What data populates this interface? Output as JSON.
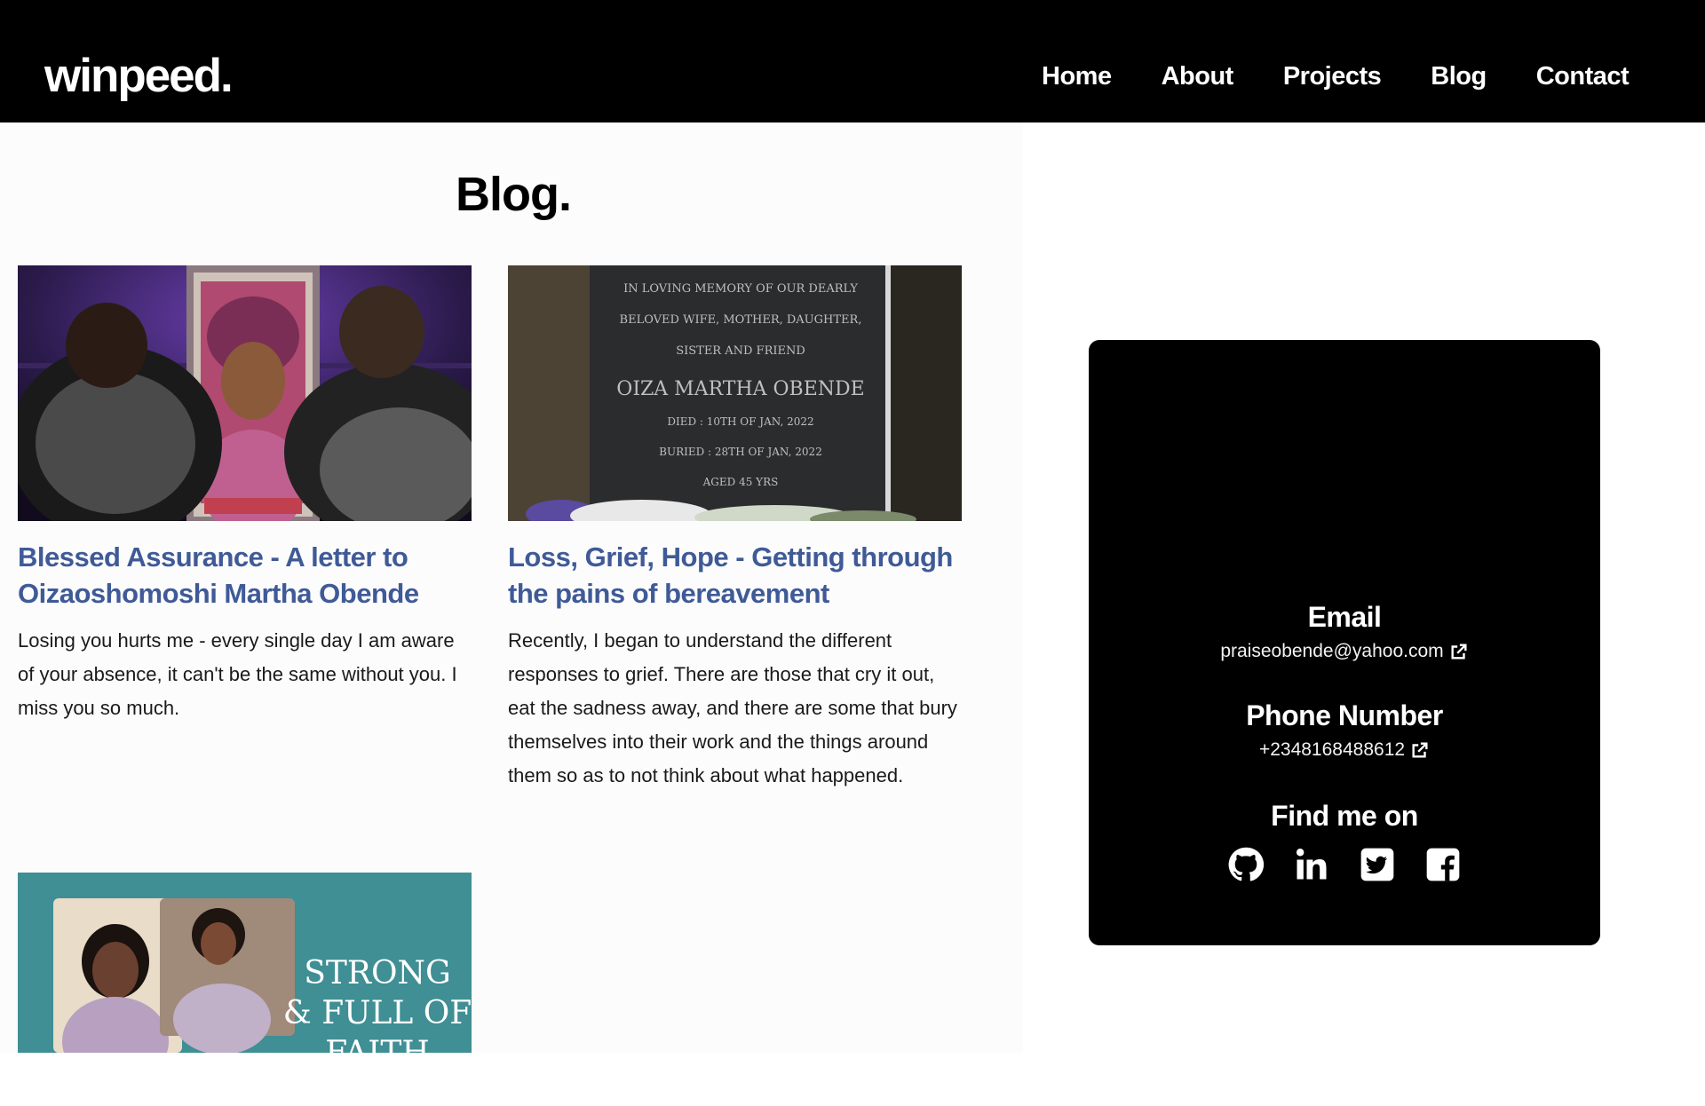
{
  "header": {
    "logo": "winpeed.",
    "nav": [
      "Home",
      "About",
      "Projects",
      "Blog",
      "Contact"
    ]
  },
  "blog": {
    "title": "Blog.",
    "posts": [
      {
        "title": "Blessed Assurance - A letter to Oizaoshomoshi Martha Obende",
        "excerpt": "Losing you hurts me - every single day I am aware of your absence, it can't be the same without you. I miss you so much."
      },
      {
        "title": "Loss, Grief, Hope - Getting through the pains of bereavement",
        "excerpt": "Recently, I began to understand the different responses to grief. There are those that cry it out, eat the sadness away, and there are some that bury themselves into their work and the things around them so as to not think about what happened.",
        "image_text": {
          "line1": "IN LOVING MEMORY OF OUR DEARLY",
          "line2": "BELOVED WIFE, MOTHER, DAUGHTER,",
          "line3": "SISTER AND FRIEND",
          "name": "OIZA MARTHA OBENDE",
          "died": "DIED : 10TH OF JAN, 2022",
          "buried": "BURIED : 28TH OF JAN, 2022",
          "aged": "AGED 45 YRS"
        }
      },
      {
        "title": "",
        "excerpt": "",
        "image_text": {
          "line1": "STRONG",
          "line2": "& FULL OF",
          "line3": "FAITH"
        }
      }
    ]
  },
  "contact": {
    "email_heading": "Email",
    "email": "praiseobende@yahoo.com",
    "phone_heading": "Phone Number",
    "phone": "+2348168488612",
    "find_heading": "Find me on",
    "socials": [
      "github-icon",
      "linkedin-icon",
      "twitter-icon",
      "facebook-icon"
    ]
  },
  "colors": {
    "header_bg": "#000000",
    "post_title": "#3f5a97",
    "contact_bg": "#000000"
  }
}
